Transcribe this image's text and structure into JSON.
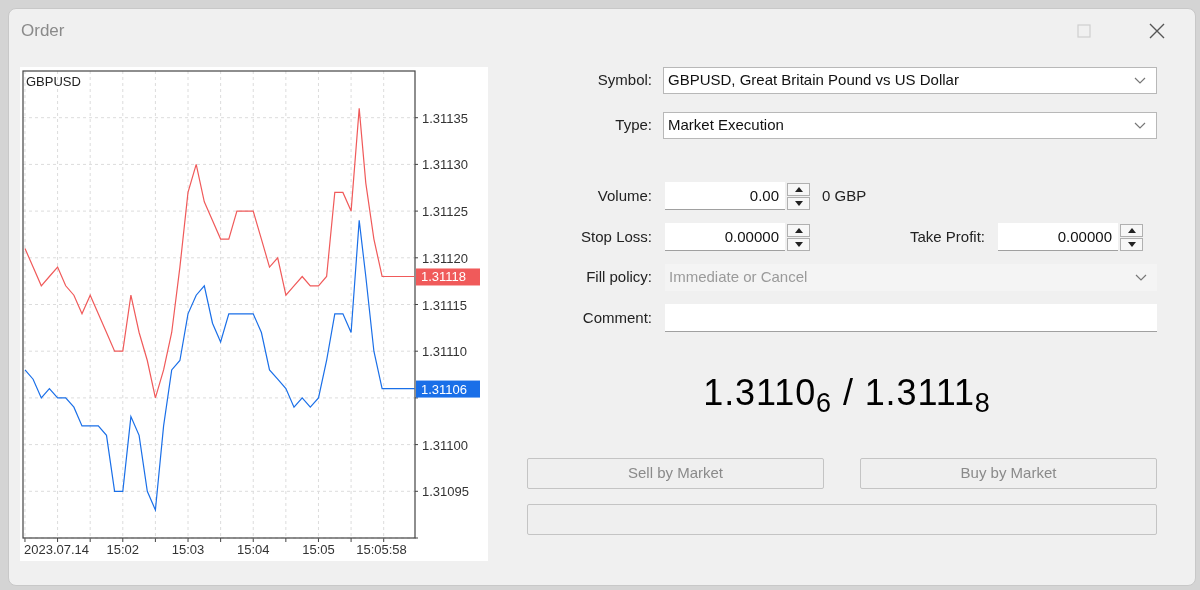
{
  "window": {
    "title": "Order"
  },
  "chart": {
    "chart_data": {
      "type": "line",
      "title": "GBPUSD",
      "x": [
        900.5,
        900.625,
        900.75,
        900.875,
        901,
        901.125,
        901.25,
        901.375,
        901.5,
        901.625,
        901.75,
        901.875,
        902,
        902.125,
        902.25,
        902.375,
        902.5,
        902.625,
        902.75,
        902.875,
        903,
        903.125,
        903.25,
        903.375,
        903.5,
        903.625,
        903.75,
        903.875,
        904,
        904.125,
        904.25,
        904.375,
        904.5,
        904.625,
        904.75,
        904.875,
        905,
        905.125,
        905.25,
        905.375,
        905.5,
        905.625,
        905.725,
        905.85,
        905.975,
        906,
        906.475
      ],
      "series": [
        {
          "color": "#f05a5a",
          "values": [
            1.31121,
            1.31119,
            1.31117,
            1.31118,
            1.31119,
            1.31117,
            1.31116,
            1.31114,
            1.31116,
            1.31114,
            1.31112,
            1.3111,
            1.3111,
            1.31116,
            1.31112,
            1.31109,
            1.31105,
            1.31108,
            1.31112,
            1.31119,
            1.31127,
            1.3113,
            1.31126,
            1.31124,
            1.31122,
            1.31122,
            1.31125,
            1.31125,
            1.31125,
            1.31122,
            1.31119,
            1.3112,
            1.31116,
            1.31117,
            1.31118,
            1.31117,
            1.31117,
            1.31118,
            1.31127,
            1.31127,
            1.31125,
            1.31136,
            1.31128,
            1.31122,
            1.31118,
            1.31118,
            1.31118
          ]
        },
        {
          "color": "#1a6fe8",
          "values": [
            1.31108,
            1.31107,
            1.31105,
            1.31106,
            1.31105,
            1.31105,
            1.31104,
            1.31102,
            1.31102,
            1.31102,
            1.31101,
            1.31095,
            1.31095,
            1.31103,
            1.31101,
            1.31095,
            1.31093,
            1.31102,
            1.31108,
            1.31109,
            1.31114,
            1.31116,
            1.31117,
            1.31113,
            1.31111,
            1.31114,
            1.31114,
            1.31114,
            1.31114,
            1.31112,
            1.31108,
            1.31107,
            1.31106,
            1.31104,
            1.31105,
            1.31104,
            1.31105,
            1.31109,
            1.31114,
            1.31114,
            1.31112,
            1.31124,
            1.31118,
            1.3111,
            1.31106,
            1.31106,
            1.31106
          ]
        }
      ],
      "ylim": [
        1.3109,
        1.3114
      ],
      "xlim": [
        900.47,
        906.48
      ],
      "grid": true,
      "yticks": [
        1.31095,
        {
          "value": 1.311,
          "label": "1.31100"
        },
        {
          "value": 1.3111,
          "label": "1.31110"
        },
        1.31115,
        {
          "value": 1.3112,
          "label": "1.31120"
        },
        1.31125,
        {
          "value": 1.3113,
          "label": "1.31130"
        },
        1.31135
      ],
      "xticks": [
        {
          "value": 902,
          "label": "15:02"
        },
        {
          "value": 903,
          "label": "15:03"
        },
        {
          "value": 904,
          "label": "15:04"
        },
        {
          "value": 905,
          "label": "15:05"
        },
        {
          "value": 905.9667,
          "label": "15:05:58"
        }
      ]
    },
    "date_label": "2023.07.14",
    "price_tags": [
      {
        "text": "1.31118",
        "color": "#f05a5a"
      },
      {
        "text": "1.31106",
        "color": "#1a6fe8"
      }
    ]
  },
  "form": {
    "symbol": {
      "label": "Symbol:",
      "value": "GBPUSD, Great Britain Pound vs US Dollar"
    },
    "type": {
      "label": "Type:",
      "value": "Market Execution"
    },
    "volume": {
      "label": "Volume:",
      "value": "0.00",
      "unit": "0 GBP"
    },
    "stop_loss": {
      "label": "Stop Loss:",
      "value": "0.00000"
    },
    "take_profit": {
      "label": "Take Profit:",
      "value": "0.00000"
    },
    "fill_policy": {
      "label": "Fill policy:",
      "value": "Immediate or Cancel",
      "disabled": true
    },
    "comment": {
      "label": "Comment:"
    }
  },
  "quote": "1.3110$_{6}$ / 1.3111$_{8}$",
  "buttons": [
    {
      "label": "Sell by Market",
      "disabled": true
    },
    {
      "label": "Buy by Market",
      "disabled": true
    }
  ]
}
